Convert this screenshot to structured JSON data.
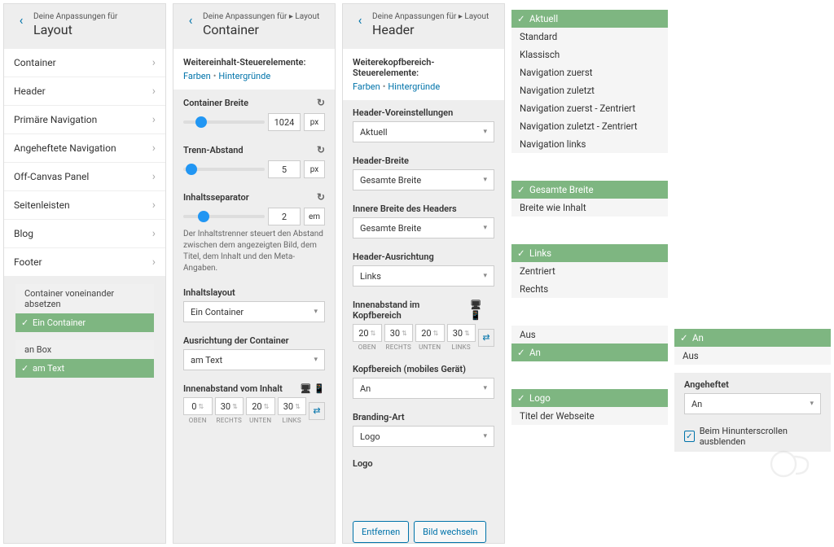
{
  "panel1": {
    "breadcrumb": "Deine Anpassungen für",
    "title": "Layout",
    "items": [
      "Container",
      "Header",
      "Primäre Navigation",
      "Angeheftete Navigation",
      "Off-Canvas Panel",
      "Seitenleisten",
      "Blog",
      "Footer"
    ],
    "group1": {
      "opt1": "Container voneinander absetzen",
      "opt2": "Ein Container"
    },
    "group2": {
      "opt1": "an Box",
      "opt2": "am Text"
    }
  },
  "panel2": {
    "breadcrumb": "Deine Anpassungen für ▸ Layout",
    "title": "Container",
    "sub_title": "Weitereinhalt-Steuerelemente:",
    "link1": "Farben",
    "link2": "Hintergründe",
    "c_breite": {
      "label": "Container Breite",
      "value": "1024",
      "unit": "px",
      "knob": 15
    },
    "trenn": {
      "label": "Trenn-Abstand",
      "value": "5",
      "unit": "px",
      "knob": 3
    },
    "sep": {
      "label": "Inhaltsseparator",
      "value": "2",
      "unit": "em",
      "knob": 18
    },
    "help": "Der Inhaltstrenner steuert den Abstand zwischen dem angezeigten Bild, dem Titel, dem Inhalt und den Meta-Angaben.",
    "layout": {
      "label": "Inhaltslayout",
      "value": "Ein Container"
    },
    "align": {
      "label": "Ausrichtung der Container",
      "value": "am Text"
    },
    "pad": {
      "label": "Innenabstand vom Inhalt",
      "v": [
        "0",
        "30",
        "20",
        "30"
      ],
      "l": [
        "OBEN",
        "RECHTS",
        "UNTEN",
        "LINKS"
      ]
    }
  },
  "panel3": {
    "breadcrumb": "Deine Anpassungen für ▸ Layout",
    "title": "Header",
    "sub_title": "Weiterekopfbereich-Steuerelemente:",
    "link1": "Farben",
    "link2": "Hintergründe",
    "preset": {
      "label": "Header-Voreinstellungen",
      "value": "Aktuell"
    },
    "hbreite": {
      "label": "Header-Breite",
      "value": "Gesamte Breite"
    },
    "ibreite": {
      "label": "Innere Breite des Headers",
      "value": "Gesamte Breite"
    },
    "halign": {
      "label": "Header-Ausrichtung",
      "value": "Links"
    },
    "hpad": {
      "label": "Innenabstand im Kopfbereich",
      "v": [
        "20",
        "30",
        "20",
        "30"
      ],
      "l": [
        "OBEN",
        "RECHTS",
        "UNTEN",
        "LINKS"
      ]
    },
    "mobil": {
      "label": "Kopfbereich (mobiles Gerät)",
      "value": "An"
    },
    "brand": {
      "label": "Branding-Art",
      "value": "Logo"
    },
    "logo_label": "Logo",
    "btn1": "Entfernen",
    "btn2": "Bild wechseln"
  },
  "panel4": {
    "presets": [
      "Aktuell",
      "Standard",
      "Klassisch",
      "Navigation zuerst",
      "Navigation zuletzt",
      "Navigation zuerst - Zentriert",
      "Navigation zuletzt - Zentriert",
      "Navigation links"
    ],
    "presets_sel": 0,
    "breite": [
      "Gesamte Breite",
      "Breite wie Inhalt"
    ],
    "breite_sel": 0,
    "align": [
      "Links",
      "Zentriert",
      "Rechts"
    ],
    "align_sel": 0,
    "mobil": [
      "Aus",
      "An"
    ],
    "mobil_sel": 1,
    "brand": [
      "Logo",
      "Titel der Webseite"
    ],
    "brand_sel": 0
  },
  "panel5": {
    "mobil": [
      "An",
      "Aus"
    ],
    "mobil_sel": 0,
    "angeh_label": "Angeheftet",
    "angeh_value": "An",
    "chk_label": "Beim Hinunterscrollen ausblenden"
  }
}
